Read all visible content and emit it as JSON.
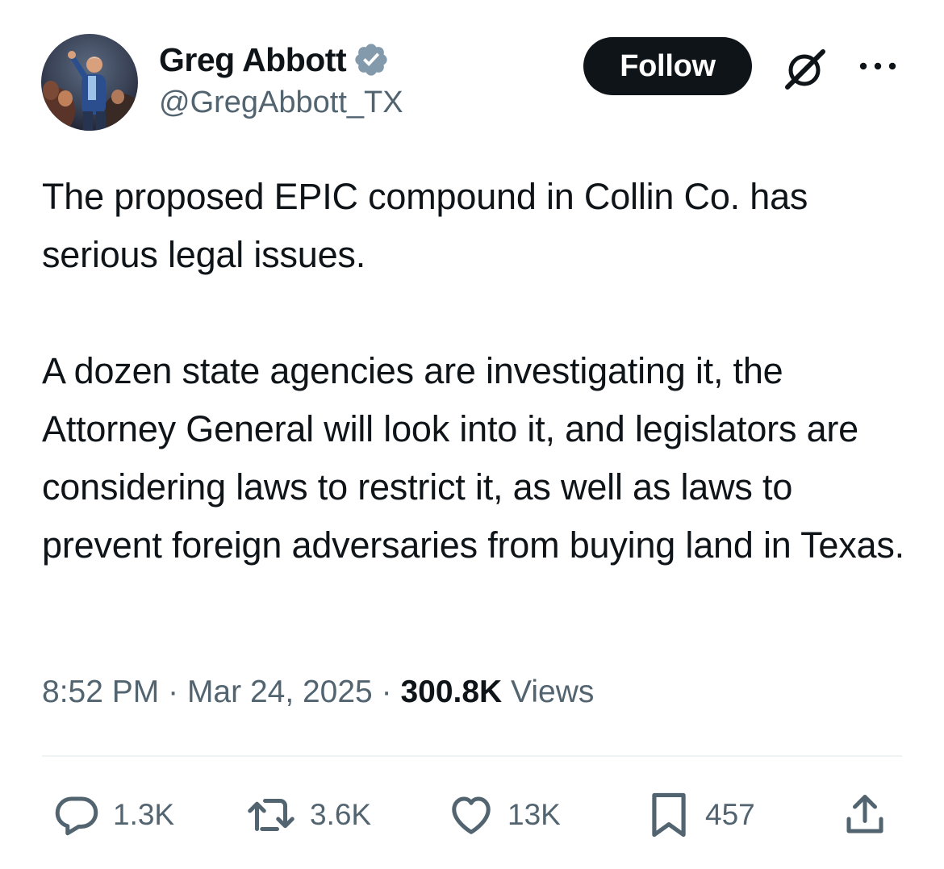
{
  "author": {
    "display_name": "Greg Abbott",
    "handle": "@GregAbbott_TX",
    "verified_badge": "verified-badge-icon",
    "badge_color": "#829aab"
  },
  "header": {
    "follow_label": "Follow",
    "grok_icon": "grok-icon",
    "more_icon": "more-icon"
  },
  "tweet": {
    "text": "The proposed EPIC compound in Collin Co. has serious legal issues.\n\nA dozen state agencies are investigating it, the Attorney General will look into it, and legislators are considering laws to restrict it, as well as laws to prevent foreign adversaries from buying land in Texas."
  },
  "meta": {
    "time": "8:52 PM",
    "separator": "·",
    "date": "Mar 24, 2025",
    "views_count": "300.8K",
    "views_label": "Views"
  },
  "actions": {
    "replies": "1.3K",
    "reposts": "3.6K",
    "likes": "13K",
    "bookmarks": "457"
  },
  "colors": {
    "text": "#0f1419",
    "secondary": "#536471",
    "follow_bg": "#0f1419",
    "divider": "#eff3f4"
  }
}
